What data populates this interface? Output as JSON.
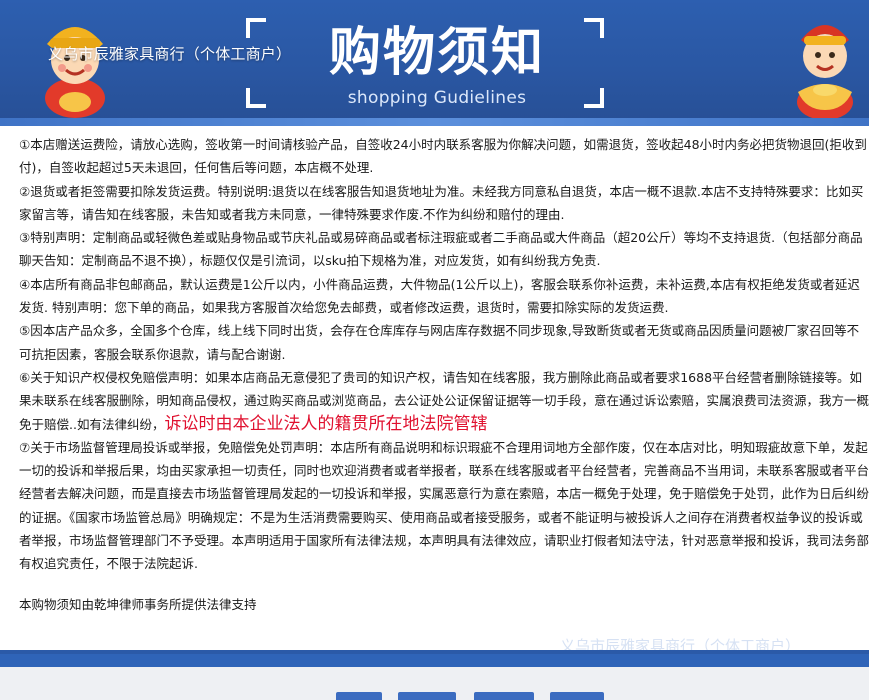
{
  "header": {
    "shop_name": "义乌市辰雅家具商行（个体工商户）",
    "title": "购物须知",
    "subtitle": "shopping Gudielines",
    "left_mascot_icon": "god-of-wealth-mascot-icon",
    "right_mascot_icon": "god-of-wealth-holding-ingot-icon"
  },
  "notice": {
    "p1": "①本店赠送运费险，请放心选购，签收第一时间请核验产品，自签收24小时内联系客服为你解决问题，如需退货，签收起48小时内务必把货物退回(拒收到付)，自签收起超过5天未退回，任何售后等问题，本店概不处理.",
    "p2": "②退货或者拒签需要扣除发货运费。特别说明:退货以在线客服告知退货地址为准。未经我方同意私自退货，本店一概不退款.本店不支持特殊要求：比如买家留言等，请告知在线客服，未告知或者我方未同意，一律特殊要求作废.不作为纠纷和赔付的理由.",
    "p3": "③特别声明：定制商品或轻微色差或贴身物品或节庆礼品或易碎商品或者标注瑕疵或者二手商品或大件商品（超20公斤）等均不支持退货.（包括部分商品聊天告知：定制商品不退不换），标题仅仅是引流词，以sku拍下规格为准，对应发货，如有纠纷我方免责.",
    "p4": "④本店所有商品非包邮商品，默认运费是1公斤以内，小件商品运费，大件物品(1公斤以上)，客服会联系你补运费，未补运费,本店有权拒绝发货或者延迟发货.   特别声明：您下单的商品，如果我方客服首次给您免去邮费，或者修改运费，退货时，需要扣除实际的发货运费.",
    "p5": "⑤因本店产品众多，全国多个仓库，线上线下同时出货，会存在仓库库存与网店库存数据不同步现象,导致断货或者无货或商品因质量问题被厂家召回等不可抗拒因素，客服会联系你退款，请与配合谢谢.",
    "p6_text": "⑥关于知识产权侵权免赔偿声明：如果本店商品无意侵犯了贵司的知识产权，请告知在线客服，我方删除此商品或者要求1688平台经营者删除链接等。如果未联系在线客服删除，明知商品侵权，通过购买商品或浏览商品，去公证处公证保留证据等一切手段，意在通过诉讼索赔，实属浪费司法资源，我方一概免于赔偿..如有法律纠纷，",
    "p6_highlight": "诉讼时由本企业法人的籍贯所在地法院管辖",
    "p7": "⑦关于市场监督管理局投诉或举报，免赔偿免处罚声明：本店所有商品说明和标识瑕疵不合理用词地方全部作废，仅在本店对比，明知瑕疵故意下单，发起一切的投诉和举报后果，均由买家承担一切责任，同时也欢迎消费者或者举报者，联系在线客服或者平台经营者，完善商品不当用词，未联系客服或者平台经营者去解决问题，而是直接去市场监督管理局发起的一切投诉和举报，实属恶意行为意在索赔，本店一概免于处理，免于赔偿免于处罚，此作为日后纠纷的证据。《国家市场监管总局》明确规定：不是为生活消费需要购买、使用商品或者接受服务，或者不能证明与被投诉人之间存在消费者权益争议的投诉或者举报，市场监督管理部门不予受理。本声明适用于国家所有法律法规，本声明具有法律效应，请职业打假者知法守法，针对恶意举报和投诉，我司法务部有权追究责任，不限于法院起诉.",
    "credit": "本购物须知由乾坤律师事务所提供法律支持"
  },
  "footer": {
    "faint_shop_name": "义乌市辰雅家具商行（个体工商户）"
  },
  "colors": {
    "banner_blue": "#2a57a3",
    "highlight_red": "#e0112f",
    "footer_blue": "#2f64b8"
  }
}
